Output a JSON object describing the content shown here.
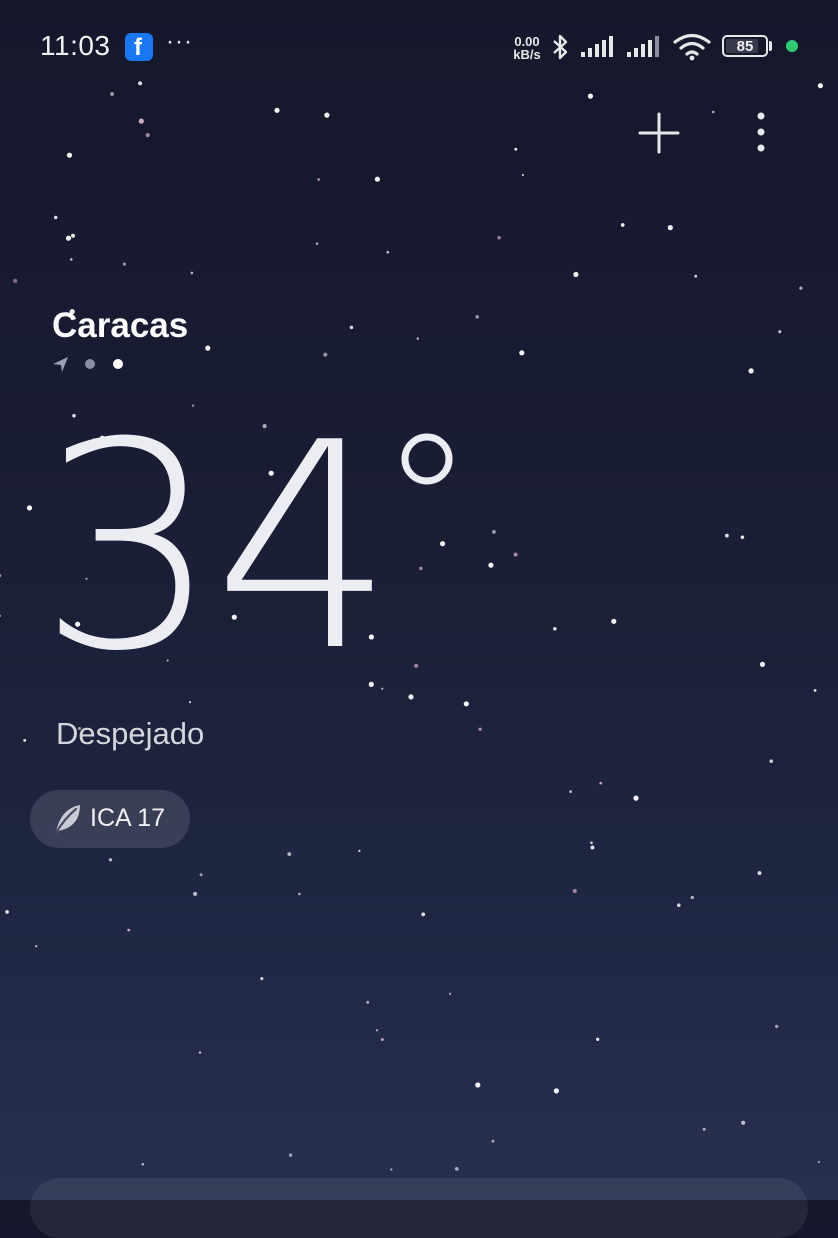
{
  "status_bar": {
    "time": "11:03",
    "notification_icons": [
      "facebook-icon"
    ],
    "more_notifications": "···",
    "net_speed_value": "0.00",
    "net_speed_unit": "kB/s",
    "battery_level": "85",
    "charging_indicator_color": "#2ecc71"
  },
  "header": {
    "add_icon": "plus-icon",
    "menu_icon": "more-vertical-icon"
  },
  "weather": {
    "city": "Caracas",
    "page_indicator": {
      "location_icon": "location-arrow-icon",
      "pages": 2,
      "active_page": 2
    },
    "temperature": "34",
    "degree_symbol": "°",
    "condition": "Despejado",
    "air_quality": {
      "icon": "leaf-icon",
      "label": "ICA 17"
    }
  },
  "colors": {
    "background_top": "#15172b",
    "background_bottom": "#28304f",
    "text_primary": "#ffffff",
    "text_secondary": "#d4d6de",
    "facebook_blue": "#1877f2"
  }
}
